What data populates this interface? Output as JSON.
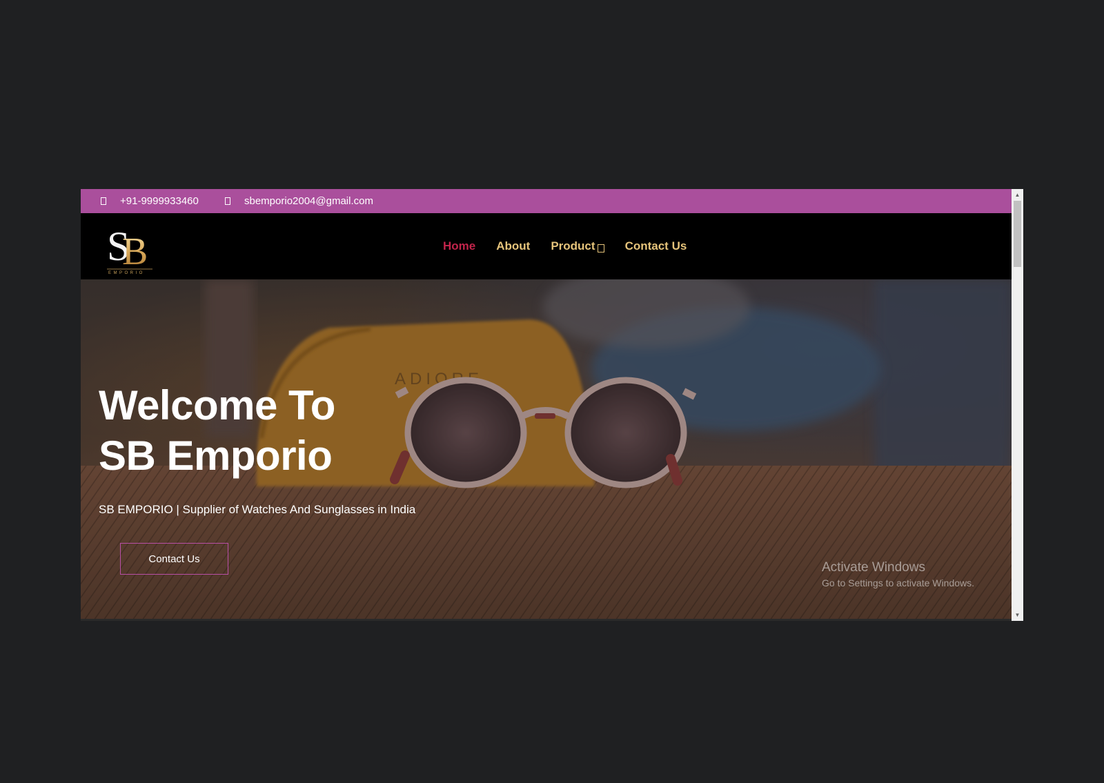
{
  "topbar": {
    "phone": "+91-9999933460",
    "email": "sbemporio2004@gmail.com",
    "phone_icon": "phone-icon",
    "email_icon": "envelope-icon",
    "background": "#aa4f9c"
  },
  "logo": {
    "monogram": "SB",
    "subtext": "EMPORIO"
  },
  "nav": {
    "items": [
      {
        "label": "Home",
        "active": true
      },
      {
        "label": "About"
      },
      {
        "label": "Product",
        "has_dropdown": true
      },
      {
        "label": "Contact Us"
      }
    ],
    "active_color": "#c2244b",
    "color": "#e6c47b"
  },
  "hero": {
    "title_line1": "Welcome To",
    "title_line2": "SB Emporio",
    "subtitle": "SB EMPORIO | Supplier of Watches And Sunglasses in India",
    "button_label": "Contact Us",
    "case_text": "ADIORE"
  },
  "watermark": {
    "line1": "Activate Windows",
    "line2": "Go to Settings to activate Windows."
  }
}
